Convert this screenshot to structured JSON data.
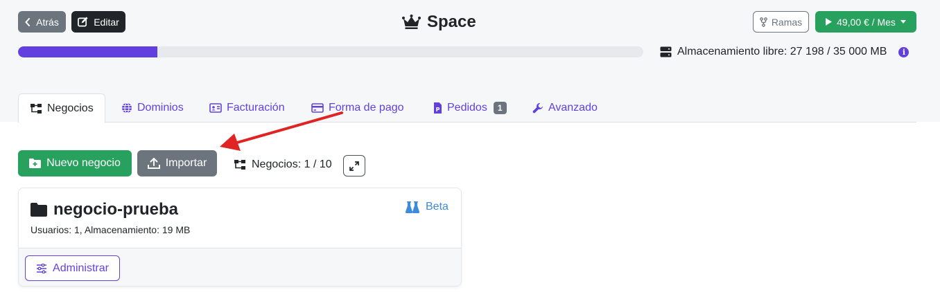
{
  "header": {
    "back_label": "Atrás",
    "edit_label": "Editar",
    "title": "Space",
    "branches_label": "Ramas",
    "price_label": "49,00 € / Mes"
  },
  "storage": {
    "text": "Almacenamiento libre: 27 198 / 35 000 MB",
    "info_glyph": "i",
    "used_fraction": 0.223
  },
  "tabs": [
    {
      "label": "Negocios",
      "icon": "sitemap-icon",
      "active": true
    },
    {
      "label": "Dominios",
      "icon": "globe-icon"
    },
    {
      "label": "Facturación",
      "icon": "id-card-icon"
    },
    {
      "label": "Forma de pago",
      "icon": "credit-card-icon"
    },
    {
      "label": "Pedidos",
      "icon": "file-invoice-icon",
      "badge": "1"
    },
    {
      "label": "Avanzado",
      "icon": "wrench-icon"
    }
  ],
  "toolbar": {
    "new_label": "Nuevo negocio",
    "import_label": "Importar",
    "count_label": "Negocios: 1 / 10"
  },
  "business": {
    "name": "negocio-prueba",
    "tag": "Beta",
    "meta": "Usuarios: 1, Almacenamiento: 19 MB",
    "manage_label": "Administrar"
  },
  "colors": {
    "accent": "#6240e0",
    "success": "#28a05e",
    "secondary": "#6c757d",
    "annotation": "#e02424"
  }
}
